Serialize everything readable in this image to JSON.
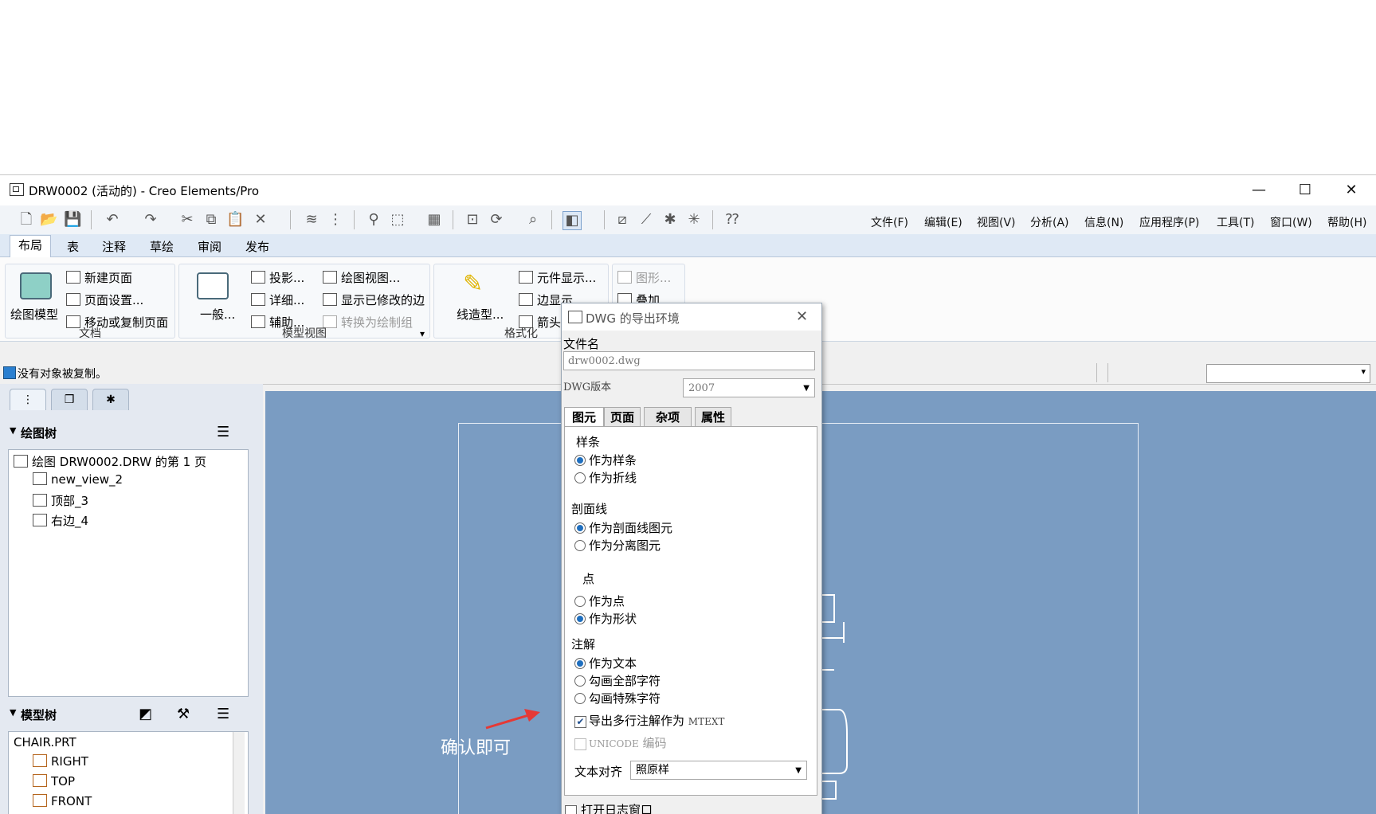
{
  "window": {
    "title": "DRW0002 (活动的) - Creo Elements/Pro",
    "controls": [
      "—",
      "☐",
      "✕"
    ]
  },
  "menubar": [
    "文件(F)",
    "编辑(E)",
    "视图(V)",
    "分析(A)",
    "信息(N)",
    "应用程序(P)",
    "工具(T)",
    "窗口(W)",
    "帮助(H)"
  ],
  "ribbon_tabs": [
    "布局",
    "表",
    "注释",
    "草绘",
    "审阅",
    "发布"
  ],
  "ribbon": {
    "doc": {
      "big": "绘图模型",
      "items": [
        "新建页面",
        "页面设置...",
        "移动或复制页面"
      ],
      "label": "文档"
    },
    "model_view": {
      "big": "一般...",
      "items": [
        "投影...",
        "详细...",
        "辅助...",
        "绘图视图...",
        "显示已修改的边",
        "转换为绘制组"
      ],
      "label": "模型视图",
      "more": "▾"
    },
    "format": {
      "big": "线造型...",
      "items": [
        "元件显示...",
        "边显示...",
        "箭头"
      ],
      "label": "格式化"
    },
    "extra": {
      "items": [
        "图形...",
        "叠加"
      ]
    }
  },
  "status": {
    "message": "没有对象被复制。"
  },
  "left_panel": {
    "tabs": [
      "tree-icon",
      "layers-icon",
      "folder-star-icon"
    ],
    "drawing_tree": {
      "title": "绘图树",
      "root": "绘图 DRW0002.DRW 的第 1 页",
      "items": [
        "new_view_2",
        "顶部_3",
        "右边_4"
      ]
    },
    "model_tree": {
      "title": "模型树",
      "root": "CHAIR.PRT",
      "items": [
        "RIGHT",
        "TOP",
        "FRONT"
      ]
    }
  },
  "dialog": {
    "title": "DWG 的导出环境",
    "filename_label": "文件名",
    "filename_value": "drw0002.dwg",
    "version_label": "DWG版本",
    "version_value": "2007",
    "tabs": [
      "图元",
      "页面",
      "杂项",
      "属性"
    ],
    "sections": {
      "spline": {
        "title": "样条",
        "options": [
          "作为样条",
          "作为折线"
        ],
        "selected": 0
      },
      "hatch": {
        "title": "剖面线",
        "options": [
          "作为剖面线图元",
          "作为分离图元"
        ],
        "selected": 0
      },
      "point": {
        "title": "点",
        "options": [
          "作为点",
          "作为形状"
        ],
        "selected": 1
      },
      "note": {
        "title": "注解",
        "options": [
          "作为文本",
          "勾画全部字符",
          "勾画特殊字符"
        ],
        "selected": 0
      }
    },
    "checkbox_mtext_a": "导出多行注解作为",
    "checkbox_mtext_b": "MTEXT",
    "checkbox_mtext_checked": true,
    "checkbox_unicode_a": "UNICODE",
    "checkbox_unicode_b": "编码",
    "checkbox_unicode_checked": false,
    "text_align_label": "文本对齐",
    "text_align_value": "照原样",
    "log_window": "打开日志窗口"
  },
  "annotation": {
    "text": "确认即可",
    "color": "#e53935"
  },
  "colors": {
    "canvas": "#7a9cc2",
    "ribbon_tab": "#dfe9f5",
    "radio": "#1f6fbf"
  }
}
